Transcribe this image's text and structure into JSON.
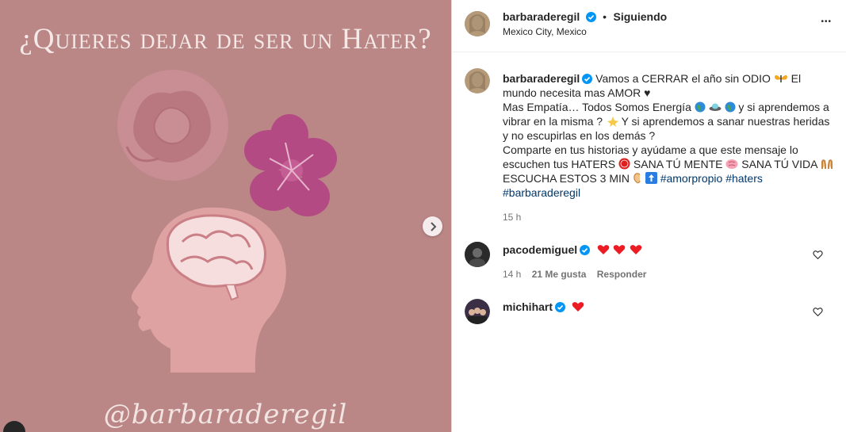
{
  "post": {
    "title": "¿Quieres dejar de ser un Hater?",
    "handle": "@barbaraderegil"
  },
  "header": {
    "username": "barbaraderegil",
    "dot": "•",
    "follow_status": "Siguiendo",
    "location": "Mexico City, Mexico",
    "more": "•••"
  },
  "caption": {
    "username": "barbaraderegil",
    "p1": "Vamos a CERRAR el año sin ODIO",
    "p2": "El mundo necesita mas AMOR ♥",
    "p3a": "Mas Empatía… Todos Somos Energía",
    "p3b": "y si aprendemos a vibrar en la misma ?",
    "p3c": "Y si aprendemos a sanar nuestras heridas y no escupirlas en los demás ?",
    "p4": "Comparte en tus historias y ayúdame a que este mensaje lo escuchen tus HATERS",
    "p5": "SANA TÚ MENTE",
    "p6": "SANA TÚ VIDA",
    "p7": "ESCUCHA ESTOS 3 MIN",
    "hashtag1": "#amorpropio",
    "hashtag2": "#haters",
    "hashtag3": "#barbaraderegil",
    "time": "15 h"
  },
  "comments": [
    {
      "username": "pacodemiguel",
      "time": "14 h",
      "likes": "21 Me gusta",
      "reply": "Responder"
    },
    {
      "username": "michihart"
    }
  ],
  "colors": {
    "bg_media": "#ba8686",
    "verified": "#0095f6",
    "heart_red": "#ed1c24"
  }
}
